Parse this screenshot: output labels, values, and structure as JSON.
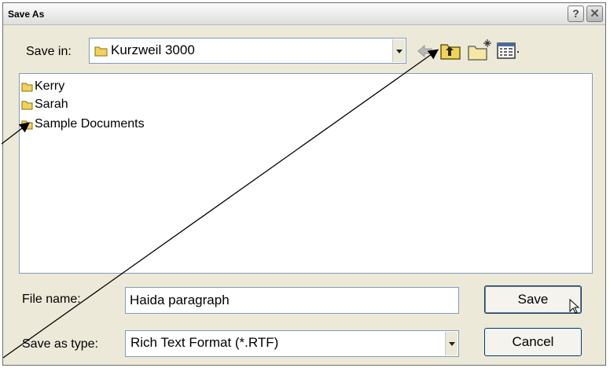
{
  "titlebar": {
    "title": "Save As",
    "help_glyph": "?",
    "close_glyph": "✕"
  },
  "save_in": {
    "label": "Save in:",
    "value": "Kurzweil 3000"
  },
  "toolbar": {
    "icons": [
      "back-arrow-icon",
      "up-folder-icon",
      "new-folder-icon",
      "view-menu-icon"
    ]
  },
  "files": [
    {
      "name": "Kerry",
      "icon": "folder-icon"
    },
    {
      "name": "Sarah",
      "icon": "folder-icon"
    },
    {
      "name": "Sample Documents",
      "icon": "folder-icon"
    }
  ],
  "file_name": {
    "label": "File name:",
    "value": "Haida paragraph"
  },
  "save_as_type": {
    "label": "Save as type:",
    "value": "Rich Text Format (*.RTF)"
  },
  "buttons": {
    "save": "Save",
    "cancel": "Cancel"
  },
  "colors": {
    "dialog_bg": "#ece9d8",
    "field_border": "#7f9db9",
    "folder_yellow": "#f2d35a"
  }
}
